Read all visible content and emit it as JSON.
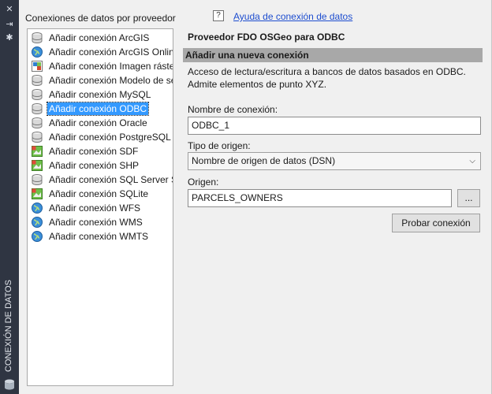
{
  "palette": {
    "left_strip": "#2f3542",
    "selection": "#3399ff",
    "link": "#1d4dcf",
    "section_bar": "#a8a8a8"
  },
  "side_strip": {
    "title": "CONEXIÓN DE DATOS",
    "buttons": [
      {
        "name": "close-icon",
        "glyph": "✕"
      },
      {
        "name": "pin-icon",
        "glyph": "⇥"
      },
      {
        "name": "gear-icon",
        "glyph": "✱"
      }
    ]
  },
  "list_heading": "Conexiones de datos por proveedor",
  "providers": [
    {
      "label": "Añadir conexión ArcGIS",
      "icon": "disk-icon"
    },
    {
      "label": "Añadir conexión ArcGIS Online",
      "icon": "globe-icon"
    },
    {
      "label": "Añadir conexión Imagen ráster",
      "icon": "raster-icon"
    },
    {
      "label": "Añadir conexión Modelo de servidor",
      "icon": "disk-icon"
    },
    {
      "label": "Añadir conexión MySQL",
      "icon": "disk-icon"
    },
    {
      "label": "Añadir conexión ODBC",
      "icon": "disk-icon",
      "selected": true
    },
    {
      "label": "Añadir conexión Oracle",
      "icon": "disk-icon"
    },
    {
      "label": "Añadir conexión PostgreSQL",
      "icon": "disk-icon"
    },
    {
      "label": "Añadir conexión SDF",
      "icon": "file-icon"
    },
    {
      "label": "Añadir conexión SHP",
      "icon": "file-icon"
    },
    {
      "label": "Añadir conexión SQL Server Spatial",
      "icon": "disk-icon"
    },
    {
      "label": "Añadir conexión SQLite",
      "icon": "file-icon"
    },
    {
      "label": "Añadir conexión WFS",
      "icon": "globe-icon"
    },
    {
      "label": "Añadir conexión WMS",
      "icon": "globe-icon"
    },
    {
      "label": "Añadir conexión WMTS",
      "icon": "globe-icon"
    }
  ],
  "help": {
    "icon_glyph": "?",
    "link": "Ayuda de conexión de datos"
  },
  "provider_title": "Proveedor FDO OSGeo para ODBC",
  "section_title": "Añadir una nueva conexión",
  "description": "Acceso de lectura/escritura a bancos de datos basados en ODBC. Admite elementos de punto XYZ.",
  "form": {
    "name_label": "Nombre de conexión:",
    "name_value": "ODBC_1",
    "source_type_label": "Tipo de origen:",
    "source_type_value": "Nombre de origen de datos (DSN)",
    "source_label": "Origen:",
    "source_value": "PARCELS_OWNERS",
    "browse_label": "...",
    "test_button": "Probar conexión"
  }
}
